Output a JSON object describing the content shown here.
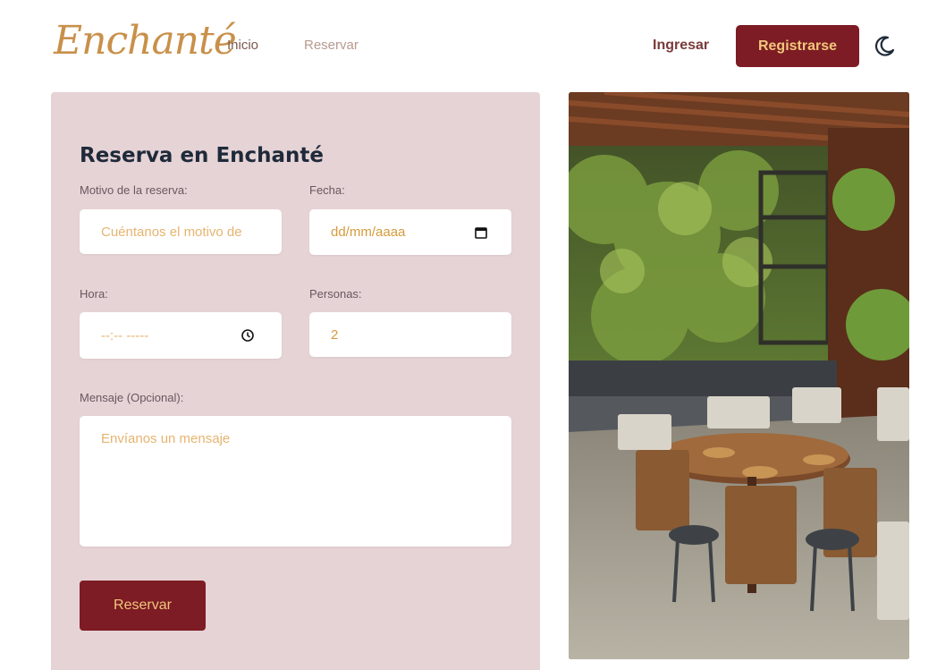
{
  "header": {
    "logo_text": "Enchanté",
    "nav": [
      {
        "label": "Inicio"
      },
      {
        "label": "Reservar"
      }
    ],
    "login_label": "Ingresar",
    "register_label": "Registrarse"
  },
  "form": {
    "title": "Reserva en Enchanté",
    "reason": {
      "label": "Motivo de la reserva:",
      "placeholder": "Cuéntanos el motivo de"
    },
    "date": {
      "label": "Fecha:",
      "placeholder": "dd/mm/aaaa"
    },
    "time": {
      "label": "Hora:",
      "placeholder": "--:-- -----"
    },
    "people": {
      "label": "Personas:",
      "value": "2"
    },
    "message": {
      "label": "Mensaje (Opcional):",
      "placeholder": "Envíanos un mensaje"
    },
    "submit_label": "Reservar"
  },
  "colors": {
    "brand": "#7d1c24",
    "accent": "#f0c77c",
    "panel_bg": "#e6d3d5",
    "logo": "#c9904a"
  },
  "icons": {
    "theme_toggle": "moon-icon",
    "date": "calendar-icon",
    "time": "clock-icon"
  }
}
